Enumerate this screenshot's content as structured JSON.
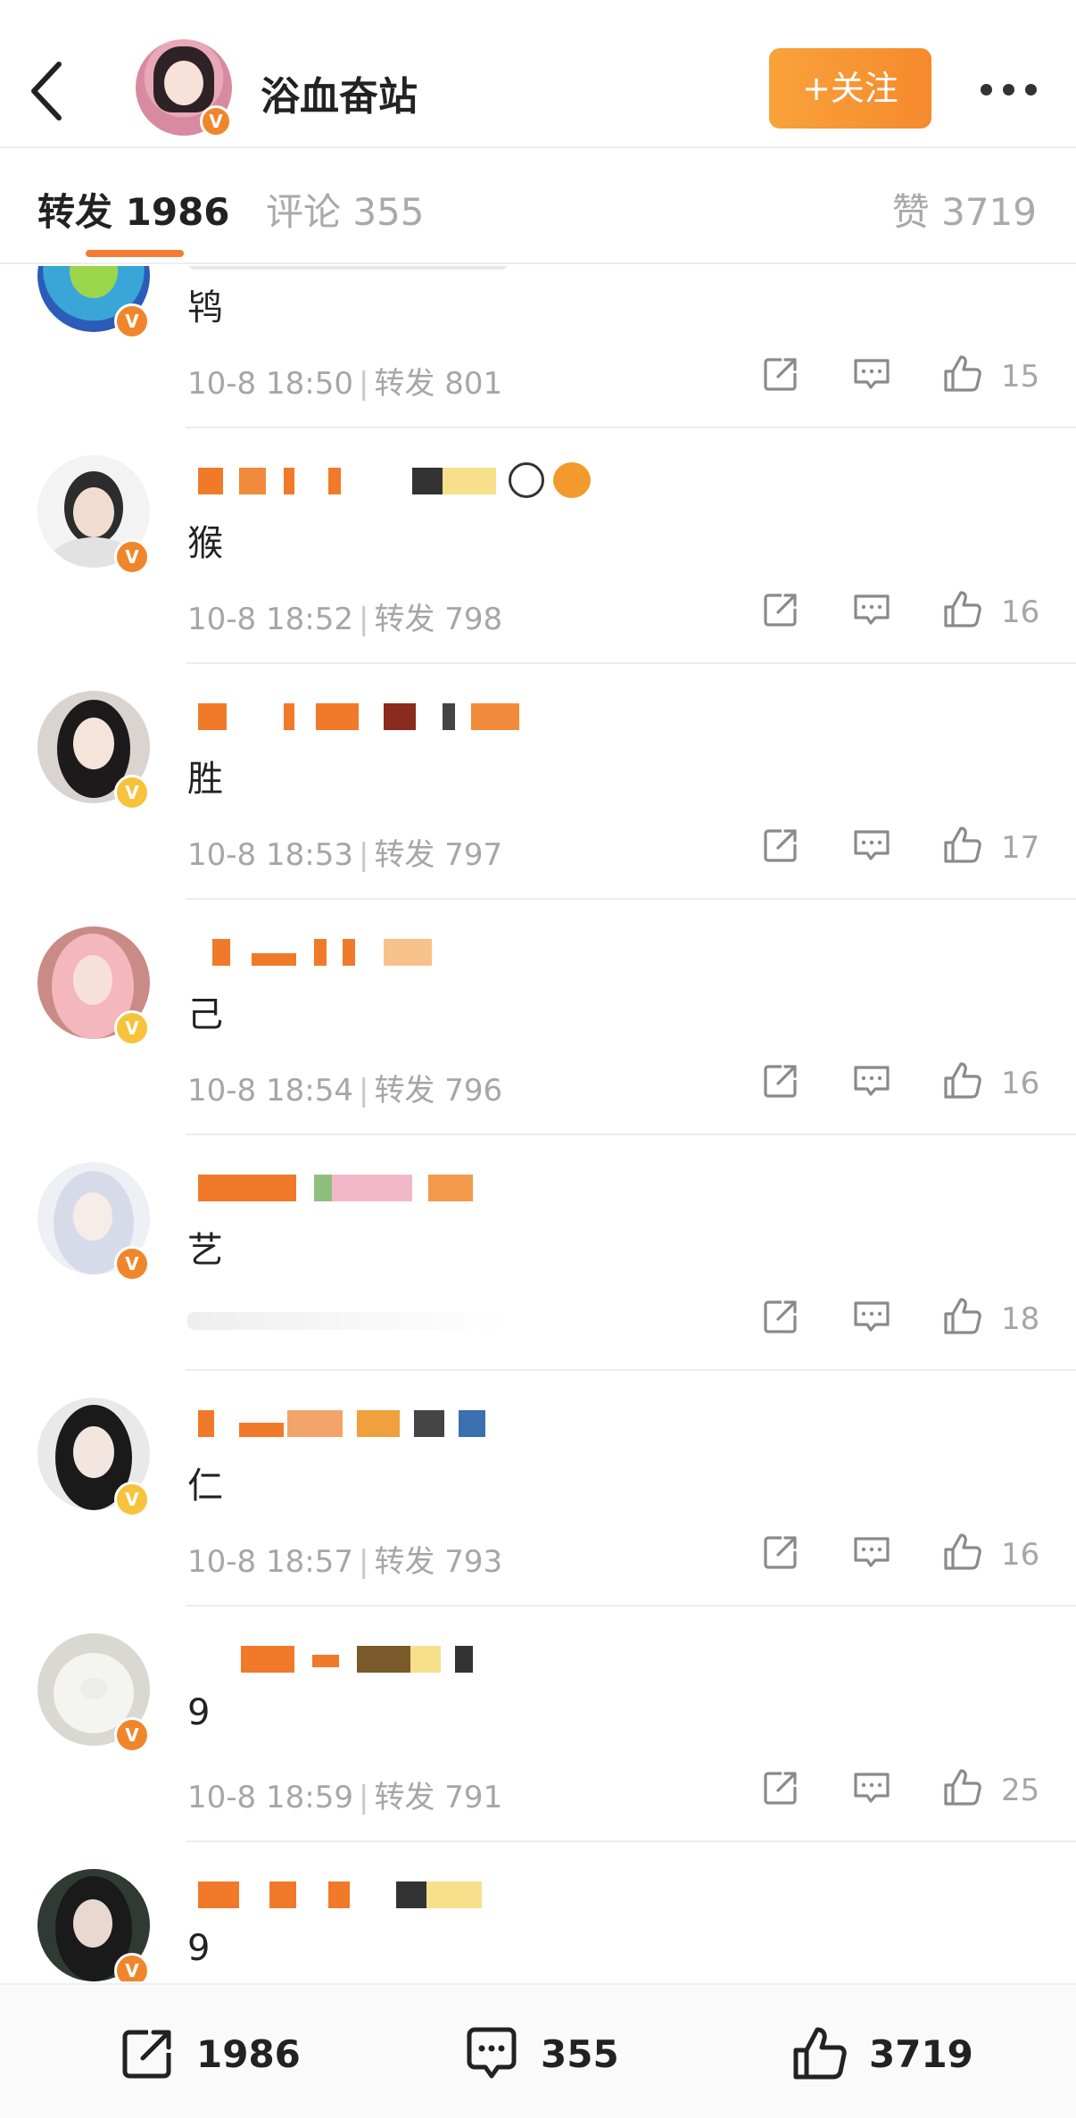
{
  "header": {
    "title": "浴血奋站",
    "follow_label": "+关注",
    "badge": "V"
  },
  "tabs": {
    "repost": "转发 1986",
    "comment": "评论 355",
    "like": "赞 3719"
  },
  "colors": {
    "accent": "#f47d33",
    "follow_button": "#f7962f",
    "verified_orange": "#f0862b",
    "verified_yellow": "#f6c33a",
    "muted_text": "#a6a6a6"
  },
  "feed": [
    {
      "content": "鸨",
      "time": "10-8 18:50",
      "repost": "转发 801",
      "likes": "15",
      "badge": "V"
    },
    {
      "content": "猴",
      "time": "10-8 18:52",
      "repost": "转发 798",
      "likes": "16",
      "badge": "V"
    },
    {
      "content": "胜",
      "time": "10-8 18:53",
      "repost": "转发 797",
      "likes": "17",
      "badge": "V"
    },
    {
      "content": "己",
      "time": "10-8 18:54",
      "repost": "转发 796",
      "likes": "16",
      "badge": "V"
    },
    {
      "content": "艺",
      "time": "",
      "repost": "",
      "likes": "18",
      "badge": "V"
    },
    {
      "content": "仁",
      "time": "10-8 18:57",
      "repost": "转发 793",
      "likes": "16",
      "badge": "V"
    },
    {
      "content": "9",
      "time": "10-8 18:59",
      "repost": "转发 791",
      "likes": "25",
      "badge": "V"
    },
    {
      "content": "9",
      "time": "",
      "repost": "",
      "likes": "",
      "badge": "V"
    }
  ],
  "bottom_bar": {
    "repost_count": "1986",
    "comment_count": "355",
    "like_count": "3719"
  },
  "icons": {
    "back": "chevron-left-icon",
    "more": "more-dots-icon",
    "share": "share-icon",
    "comment": "comment-icon",
    "like": "thumbs-up-icon"
  }
}
